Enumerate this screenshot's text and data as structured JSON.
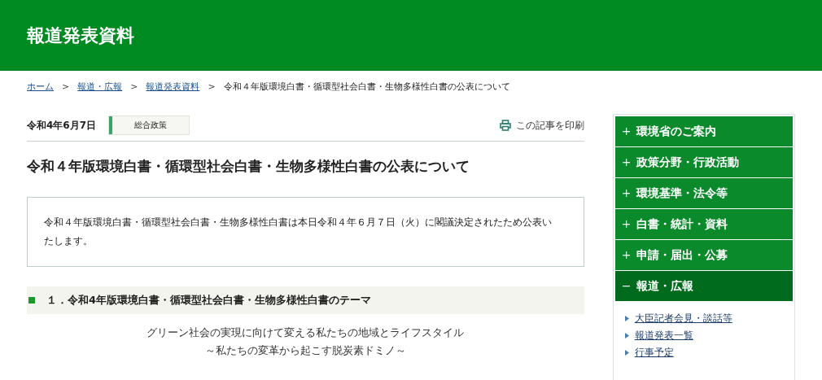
{
  "header": {
    "title": "報道発表資料"
  },
  "breadcrumb": [
    {
      "label": "ホーム",
      "link": true
    },
    {
      "label": "報道・広報",
      "link": true
    },
    {
      "label": "報道発表資料",
      "link": true
    },
    {
      "label": "令和４年版環境白書・循環型社会白書・生物多様性白書の公表について",
      "link": false
    }
  ],
  "breadcrumb_separator": ">",
  "article": {
    "date": "令和4年6月7日",
    "category": "総合政策",
    "print": "この記事を印刷",
    "title": "令和４年版環境白書・循環型社会白書・生物多様性白書の公表について",
    "summary": "令和４年版環境白書・循環型社会白書・生物多様性白書は本日令和４年６月７日（火）に閣議決定されたため公表いたします。",
    "section_heading": "１．令和4年版環境白書・循環型社会白書・生物多様性白書のテーマ",
    "theme_lines": [
      "グリーン社会の実現に向けて変える私たちの地域とライフスタイル",
      "～私たちの変革から起こす脱炭素ドミノ～"
    ]
  },
  "sidebar": {
    "items": [
      {
        "label": "環境省のご案内",
        "expanded": false,
        "marker": "+"
      },
      {
        "label": "政策分野・行政活動",
        "expanded": false,
        "marker": "+"
      },
      {
        "label": "環境基準・法令等",
        "expanded": false,
        "marker": "+"
      },
      {
        "label": "白書・統計・資料",
        "expanded": false,
        "marker": "+"
      },
      {
        "label": "申請・届出・公募",
        "expanded": false,
        "marker": "+"
      },
      {
        "label": "報道・広報",
        "expanded": true,
        "marker": "−",
        "children": [
          {
            "label": "大臣記者会見・談話等"
          },
          {
            "label": "報道発表一覧"
          },
          {
            "label": "行事予定"
          }
        ]
      }
    ]
  }
}
